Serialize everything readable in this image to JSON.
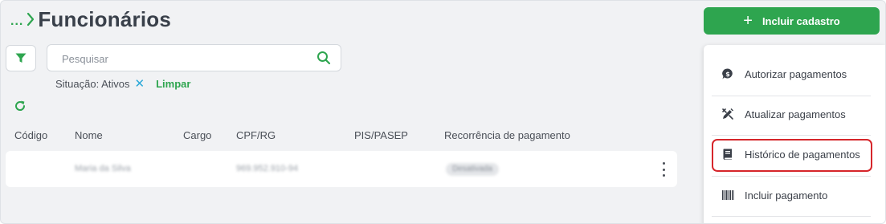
{
  "header": {
    "breadcrumb_ellipsis": "...",
    "title": "Funcionários",
    "primary_button": "Incluir cadastro"
  },
  "search": {
    "placeholder": "Pesquisar",
    "value": ""
  },
  "filters": {
    "active_chip": "Situação: Ativos",
    "clear_label": "Limpar"
  },
  "table": {
    "columns": [
      "Código",
      "Nome",
      "Cargo",
      "CPF/RG",
      "PIS/PASEP",
      "Recorrência de pagamento"
    ],
    "rows": [
      {
        "codigo": "",
        "nome": "Maria da Silva",
        "cargo": "",
        "cpf": "969.952.910-94",
        "pis": "",
        "recorrencia": "Desativada"
      }
    ]
  },
  "menu": {
    "items": [
      {
        "label": "Autorizar pagamentos",
        "icon": "dollar-chat-icon"
      },
      {
        "label": "Atualizar pagamentos",
        "icon": "edit-tools-icon"
      },
      {
        "label": "Histórico de pagamentos",
        "icon": "book-icon"
      },
      {
        "label": "Incluir pagamento",
        "icon": "barcode-icon"
      }
    ]
  },
  "colors": {
    "accent_green": "#2ea54f",
    "chip_close": "#2aa8d8",
    "highlight_red": "#d6262b"
  }
}
